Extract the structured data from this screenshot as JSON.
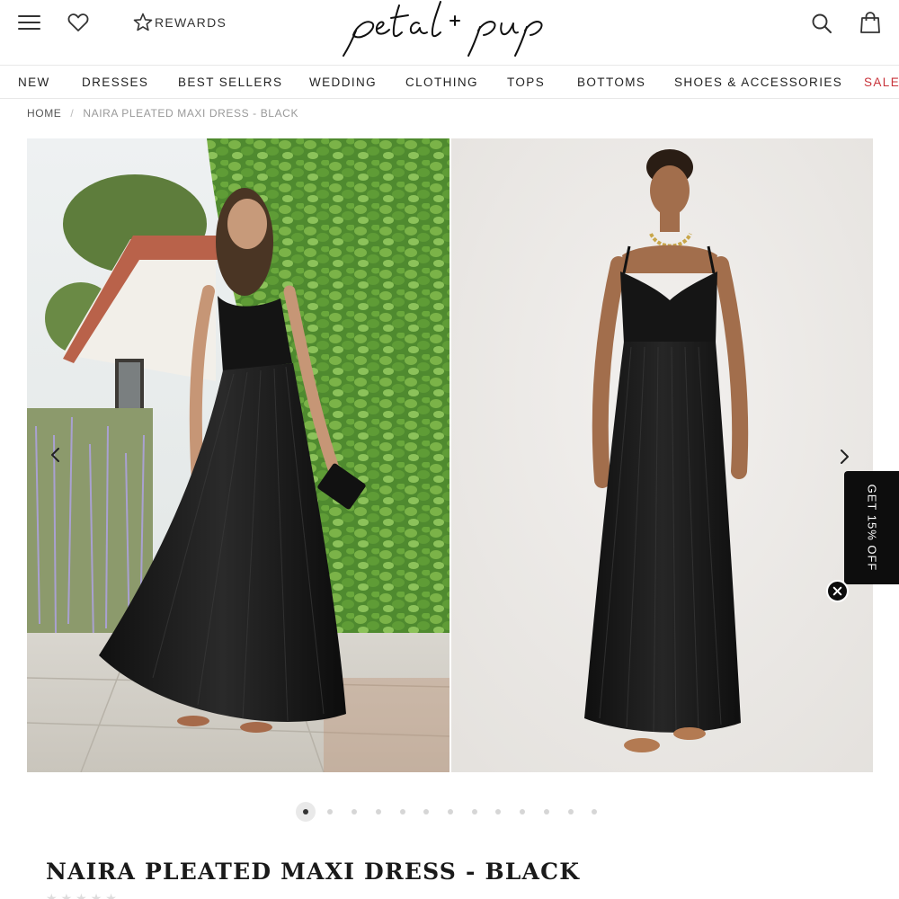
{
  "header": {
    "rewards_label": "REWARDS",
    "logo_text": "petal + pup"
  },
  "nav": {
    "items": [
      {
        "label": "NEW"
      },
      {
        "label": "DRESSES"
      },
      {
        "label": "BEST SELLERS"
      },
      {
        "label": "WEDDING"
      },
      {
        "label": "CLOTHING"
      },
      {
        "label": "TOPS"
      },
      {
        "label": "BOTTOMS"
      },
      {
        "label": "SHOES & ACCESSORIES"
      },
      {
        "label": "SALE"
      }
    ],
    "sale_color": "#c8333a"
  },
  "breadcrumb": {
    "home": "HOME",
    "separator": "/",
    "current": "NAIRA PLEATED MAXI DRESS - BLACK"
  },
  "gallery": {
    "photos": [
      {
        "alt": "model-outdoor-ivy-wall"
      },
      {
        "alt": "model-studio-front"
      }
    ],
    "slide_count": 13,
    "active_slide": 1
  },
  "promo": {
    "label": "GET 15% OFF"
  },
  "product": {
    "title": "NAIRA PLEATED MAXI DRESS - BLACK",
    "rating_stars": 5
  },
  "icons": {
    "menu": "hamburger-menu-icon",
    "wishlist": "heart-icon",
    "rewards": "star-icon",
    "search": "search-icon",
    "cart": "shopping-bag-icon",
    "prev": "chevron-left-icon",
    "next": "chevron-right-icon",
    "close": "close-icon"
  }
}
